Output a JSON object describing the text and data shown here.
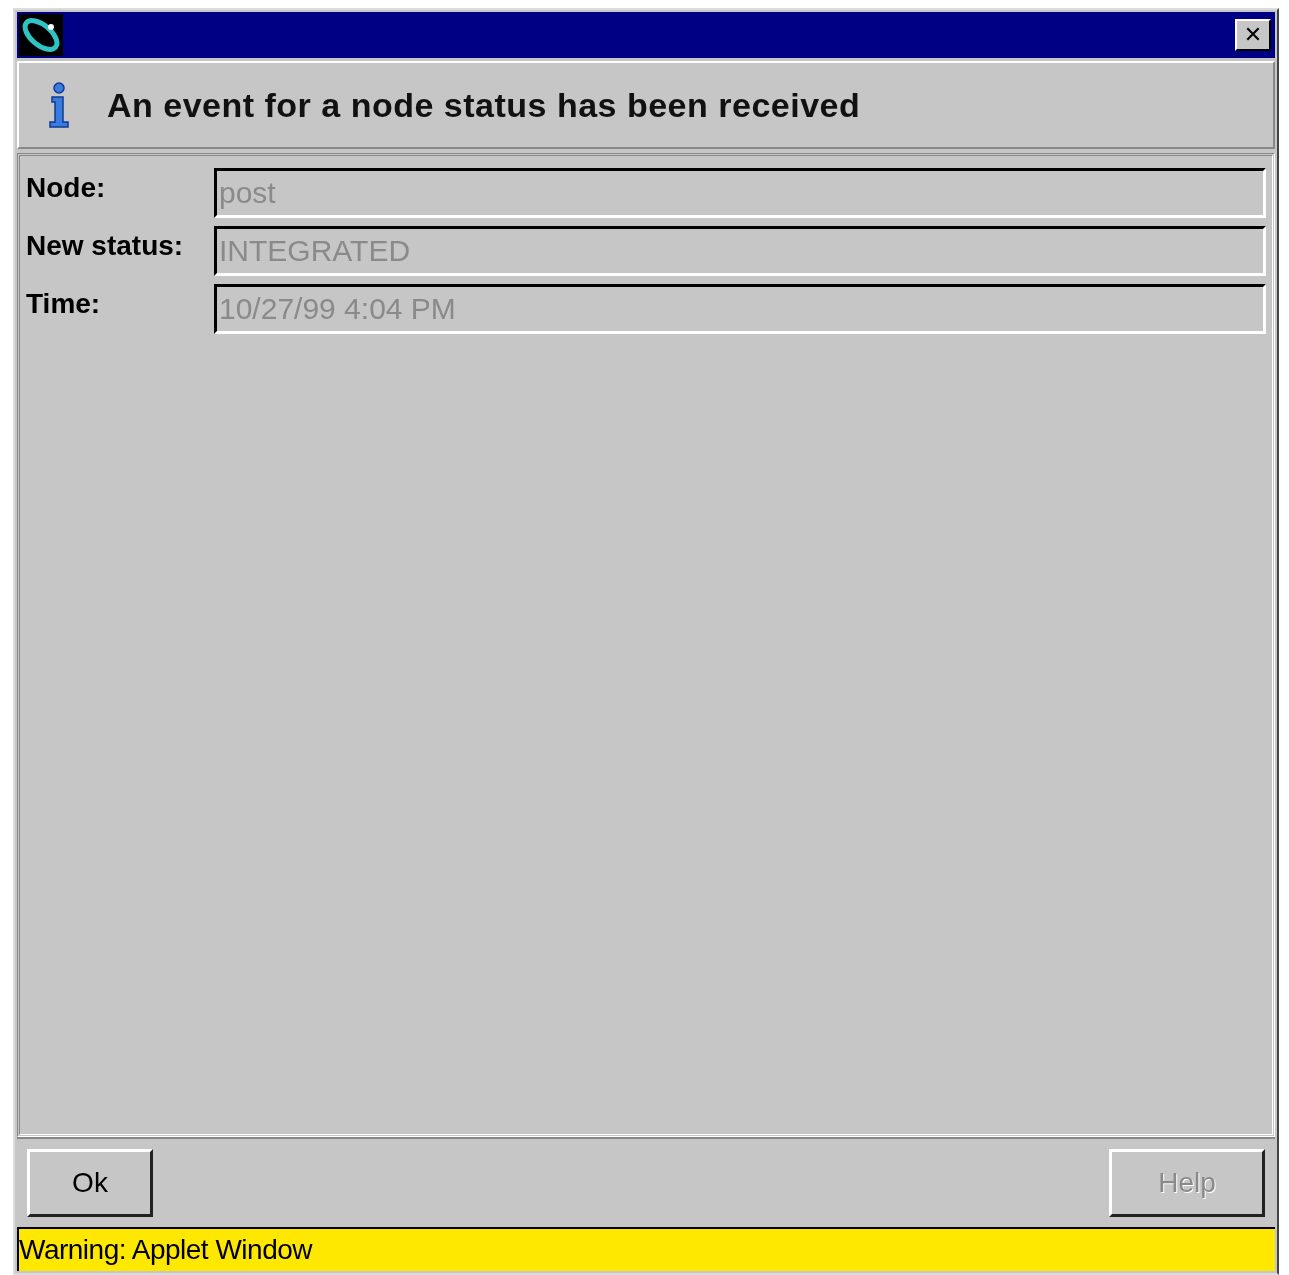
{
  "window": {
    "close_label": "✕"
  },
  "header": {
    "message": "An event for a node status has been received"
  },
  "fields": [
    {
      "label": "Node:",
      "value": "post",
      "disabled": true
    },
    {
      "label": "New status:",
      "value": "INTEGRATED",
      "disabled": true
    },
    {
      "label": "Time:",
      "value": "10/27/99 4:04 PM",
      "disabled": true
    }
  ],
  "buttons": [
    {
      "label": "Ok",
      "disabled": false
    },
    {
      "label": "Help",
      "disabled": true
    }
  ],
  "status_bar": {
    "text": "Warning: Applet Window"
  }
}
